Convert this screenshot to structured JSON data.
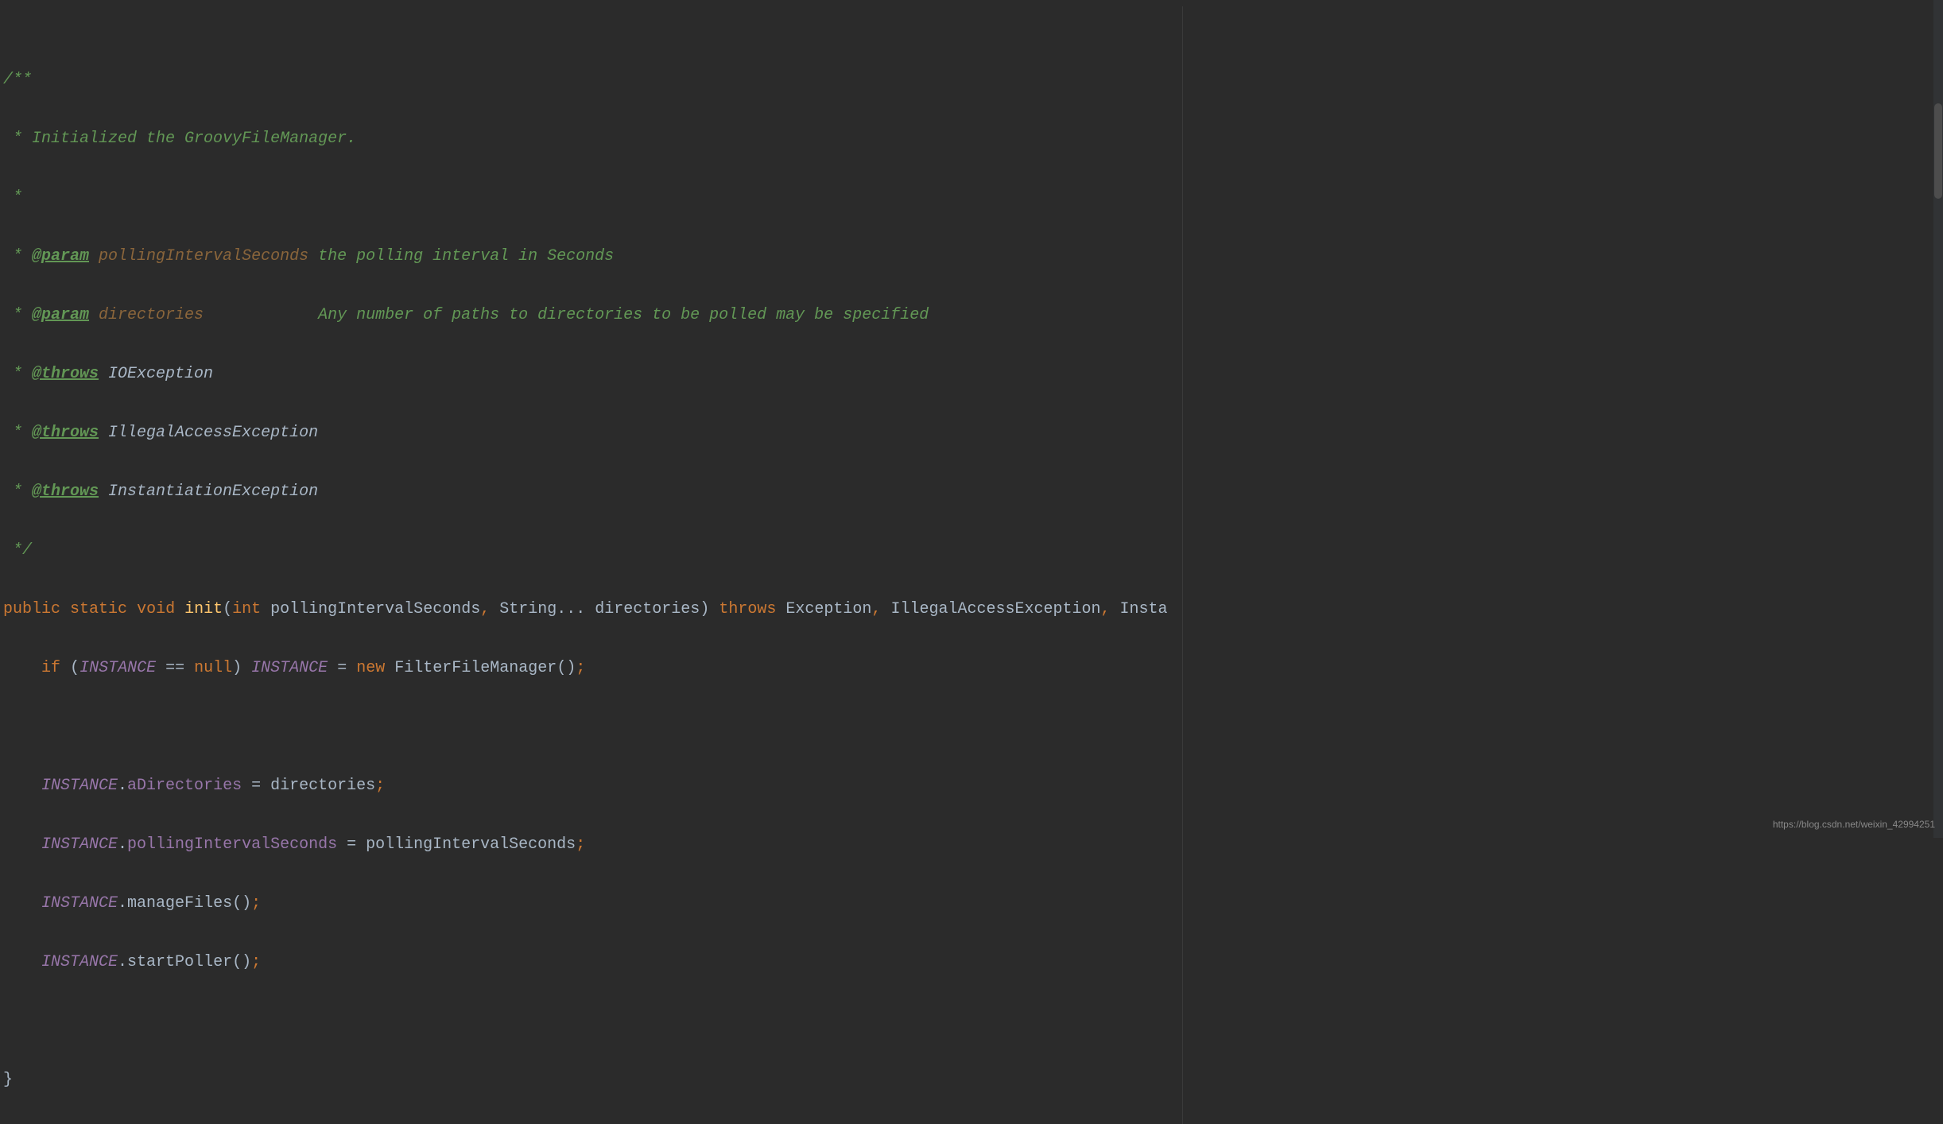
{
  "code": {
    "l1": {
      "delim": "/**"
    },
    "l2": {
      "prefix": " * ",
      "text": "Initialized the GroovyFileManager."
    },
    "l3": {
      "prefix": " *"
    },
    "l4": {
      "prefix": " * ",
      "tag": "@param",
      "name": " pollingIntervalSeconds",
      "desc": " the polling interval in Seconds"
    },
    "l5": {
      "prefix": " * ",
      "tag": "@param",
      "name": " directories           ",
      "desc": " Any number of paths to directories to be polled may be specified"
    },
    "l6": {
      "prefix": " * ",
      "tag": "@throws",
      "name": " IOException"
    },
    "l7": {
      "prefix": " * ",
      "tag": "@throws",
      "name": " IllegalAccessException"
    },
    "l8": {
      "prefix": " * ",
      "tag": "@throws",
      "name": " InstantiationException"
    },
    "l9": {
      "prefix": " */"
    },
    "l10": {
      "kw_public": "public",
      "kw_static": "static",
      "kw_void": "void",
      "method": "init",
      "kw_int": "int",
      "param1": "pollingIntervalSeconds",
      "param2_type": "String",
      "param2": "directories",
      "kw_throws": "throws",
      "ex1": "Exception",
      "ex2": "IllegalAccessException",
      "ex3": "Insta"
    },
    "l11": {
      "kw_if": "if",
      "instance": "INSTANCE",
      "kw_null": "null",
      "kw_new": "new",
      "ctor": "FilterFileManager"
    },
    "l13": {
      "instance": "INSTANCE",
      "field": "aDirectories",
      "val": "directories"
    },
    "l14": {
      "instance": "INSTANCE",
      "field": "pollingIntervalSeconds",
      "val": "pollingIntervalSeconds"
    },
    "l15": {
      "instance": "INSTANCE",
      "method": "manageFiles"
    },
    "l16": {
      "instance": "INSTANCE",
      "method": "startPoller"
    },
    "l18": {
      "brace": "}"
    }
  },
  "watermark": "https://blog.csdn.net/weixin_42994251"
}
